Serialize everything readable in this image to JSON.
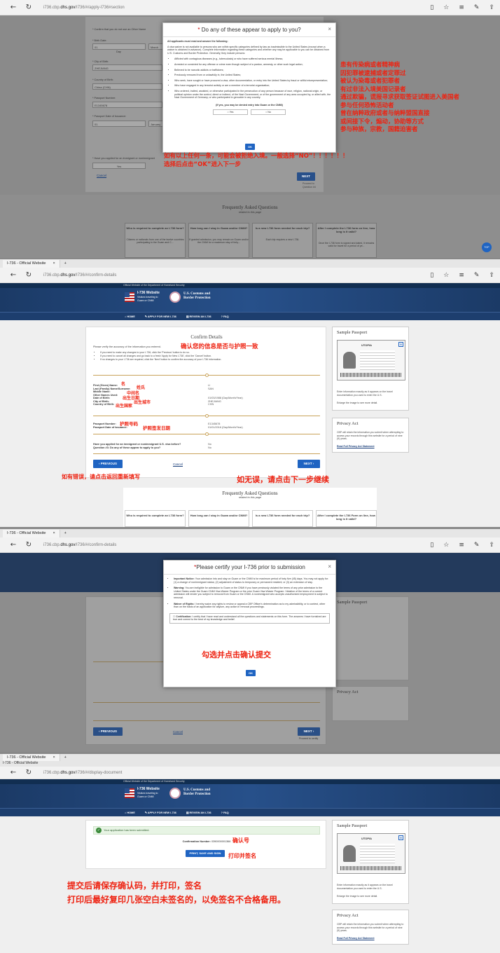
{
  "panel1": {
    "url_prefix": "i736.cbp.",
    "url_host": "dhs.gov",
    "url_path": "/I736/#/apply-I736#section",
    "confirm_other_name": "* Confirm that you do not use an Other Name",
    "birth_date_label": "* Birth Date:",
    "birth_day": "01",
    "birth_month": "March",
    "day_hint": "Day",
    "city_birth_label": "* City of Birth:",
    "city_birth": "ZHEJIANG",
    "country_birth_label": "* Country of Birth:",
    "country_birth": "China (CHN)",
    "passport_label": "* Passport Number:",
    "passport_number": "E1345678",
    "issuance_label": "* Passport Date of Issuance:",
    "issue_day": "01",
    "issue_month": "January",
    "applied_label": "* Have you applied for an immigrant or nonimmigrant",
    "yes_label": "Yes",
    "cancel": "Cancel",
    "next": "NEXT",
    "proceed": "Proceed to Question #4",
    "faq_title": "Frequently Asked Questions",
    "faq_sub": "related to this page",
    "faq": [
      {
        "q": "Who is required to complete an I-736 form?",
        "a": "Citizens or nationals from one of the twelve countries participating in the Guam and C..."
      },
      {
        "q": "How long can I stay in Guam and/or CNMI?",
        "a": "If granted admission, you may remain on Guam and/or the CNMI for a maximum stay of forty..."
      },
      {
        "q": "Is a new I-736 form needed for each trip?",
        "a": "Each trip requires a new I-736."
      },
      {
        "q": "After I complete the I-736 form on line, how long is it valid?",
        "a": "Once the I-736 form is signed and dated, it remains valid for travel for a period of ye..."
      }
    ],
    "top_label": "TOP",
    "modal": {
      "title": "Do any of these appear to apply to you?",
      "required_star": "*",
      "subhead": "All applicants must read and answer the following:",
      "intro": "A visa waiver is not available to persons who are within specific categories defined by law as inadmissible to the United States (except when a waiver is obtained in advance). Complete information regarding these categories and whether any may be applicable to you can be obtained from U.S. Customs and Border Protection. Generally, they include persons:",
      "items": [
        "Afflicted with contagious diseases (e.g., tuberculosis) or who have suffered serious mental illness;",
        "Arrested or convicted for any offense or crime even though subject of a pardon, amnesty, or other such legal action;",
        "Believed to be narcotic addicts or traffickers;",
        "Previously removed from or unlawfully in, the United States;",
        "Who seek, have sought or have procured a visa, other documentation, or entry into the United States by fraud or willful misrepresentation;",
        "Who have engaged in any terrorist activity or are a member of a terrorist organization;",
        "Who ordered, incited, assisted, or otherwise participated in the persecution of any person because of race, religion, national origin, or political opinion under the control, direct or indirect, of the Nazi Government, or of the government of any area occupied by, or allied with, the Nazi Government of Germany, or who participated in genocide in any country."
      ],
      "question": "(If yes, you may be denied entry into Guam or the CNMI)",
      "yes": "Yes",
      "no": "No",
      "ok": "OK"
    },
    "annot_right": [
      "患有传染病或者精神病",
      "因犯罪被逮捕或者定罪过",
      "被认为染毒或者犯罪者",
      "有过非法入境美国记录者",
      "通过欺骗，谎报寻求获取签证试图进入美国者",
      "参与任何恐怖活动者",
      "曾在纳粹政府或者与纳粹盟国直接",
      "或间接下令，煽动，协助等方式",
      "参与种族，宗教，国籍迫害者"
    ],
    "annot_bottom": [
      "如有以上任何一条，可能会被拒绝入境。一般选择“NO”！！！！！！",
      "选择后点击“OK”进入下一步"
    ]
  },
  "panel2": {
    "tab_title": "I-736 - Official Website",
    "url_prefix": "i736.cbp.",
    "url_host": "dhs.gov",
    "url_path": "/I736/#/confirm-details",
    "official": "Official Website of the Department of Homeland Security",
    "site_title": "I-736 Website",
    "site_sub1": "Visitors traveling to",
    "site_sub2": "Guam or CNMI",
    "cbp1": "U.S. Customs and",
    "cbp2": "Border Protection",
    "menu": [
      "HOME",
      "APPLY FOR NEW I-736",
      "REVIEW AN I-736",
      "FAQ"
    ],
    "heading": "Confirm Details",
    "verify": "Please verify the accuracy of the information you entered.",
    "bullets": [
      "If you need to make any changes to your I-736, click the 'Previous' button to do so.",
      "If you need to cancel all changes and go back to a fresh 'Apply for New I-736', click the 'Cancel' button.",
      "If no changes to your I-736 are required, click the 'Next' button to confirm the accuracy of your I-736 information."
    ],
    "fields": [
      "First (Given) Name:",
      "Last (Family) Name/Surname:",
      "Middle Name:",
      "Other Names Used:",
      "Date of Birth:",
      "City of Birth:",
      "Country of Birth:"
    ],
    "values": [
      "LI",
      "SAN",
      "",
      "",
      "01/03/1988 (Day/Month/Year)",
      "ZHEJIANG",
      "CHN"
    ],
    "pp_fields": [
      "Passport Number:",
      "Passport Date of Issuance:"
    ],
    "pp_values": [
      "E1345678",
      "01/01/2016 (Day/Month/Year)"
    ],
    "q_fields": [
      "Have you applied for an immigrant or nonimmigrant U.S. visa before?",
      "Question #3: Do any of these appear to apply to you?"
    ],
    "q_values": [
      "No",
      "No"
    ],
    "previous": "PREVIOUS",
    "cancel": "Cancel",
    "next": "NEXT",
    "sample_passport": "Sample Passport",
    "utopia": "UTOPIA",
    "sample_desc": "Enter information exactly as it appears on the travel documentation you used to enter the U.S.",
    "enlarge": "Enlarge the image to see more detail.",
    "privacy_title": "Privacy Act",
    "privacy_text": "CBP will retain the information you submit when attempting to access your records through this website for a period of nine (9) years.",
    "privacy_link": "Read Full Privacy Act Statement",
    "faq_title": "Frequently Asked Questions",
    "faq_sub": "related to this page",
    "faq": [
      "Who is required to complete an I-736 form?",
      "How long can I stay in Guam and/or CNMI?",
      "Is a new I-736 form needed for each trip?",
      "After I complete the I-736 Form on line, how long is it valid?"
    ],
    "annot": {
      "title": "确认您的信息是否与护照一致",
      "given": "名",
      "family": "姓氏",
      "middle": "中间名",
      "dob": "出生日期",
      "city": "出生城市",
      "country": "出生国家",
      "pp": "护照号码",
      "issue": "护照签发日期",
      "wrong": "如有错误，请点击返回重新填写",
      "right": "如无误，请点击下一步继续"
    }
  },
  "panel3": {
    "tab_title": "I-736 - Official Website",
    "url_prefix": "i736.cbp.",
    "url_host": "dhs.gov",
    "url_path": "/I736/#/confirm-details",
    "modal_title": "Please certify your I-736 prior to submission",
    "required_star": "*",
    "items": [
      {
        "head": "Important Notice:",
        "text": "Your admission into and stay on Guam or the CNMI is for maximum period of forty five (45) days. You may not apply for: (1) a change of nonimmigrant status; (2) adjustment of status to temporary or permanent resident; or (3) an extension of stay."
      },
      {
        "head": "Warning:",
        "text": "You are ineligible for admission to Guam or the CNMI if you have previously violated the terms of any prior admission to the United States under the Guam CNMI Visa Waiver Program or the prior Guam Visa Waiver Program. Violation of the terms of a current admission will render you subject to removal from Guam or the CNMI. A nonimmigrant who accepts unauthorized employment is subject to removal."
      },
      {
        "head": "Waiver of Rights:",
        "text": "I hereby waive any rights to review or appeal a CBP Officer's determination as to my admissibility, or to contest, other than on the basis of an application for asylum, any action in removal proceedings."
      }
    ],
    "cert_head": "Certification:",
    "cert_text": "I certify that I have read and understand all the questions and statements on this form. The answers I have furnished are true and correct to the best of my knowledge and belief.",
    "ok": "OK",
    "previous": "PREVIOUS",
    "cancel": "Cancel",
    "next": "NEXT",
    "proceed": "Proceed to certify",
    "sample_passport": "Sample Passport",
    "privacy_title": "Privacy Act",
    "annot": "勾选并点击确认提交"
  },
  "panel4": {
    "tab_title": "I-736 - Official Website",
    "tab_title2": "I-736 - Official Website",
    "url_prefix": "i736.cbp.",
    "url_host": "dhs.gov",
    "url_path": "/I736/#/display-document",
    "submitted": "Your application has been submitted.",
    "conf_label": "Confirmation Number:",
    "conf_number": "0390000001366",
    "print": "PRINT, SAVE AND SIGN",
    "sample_passport": "Sample Passport",
    "utopia": "UTOPIA",
    "sample_desc": "Enter information exactly as it appears on the travel documentation you used to enter the U.S.",
    "enlarge": "Enlarge the image to see more detail.",
    "privacy_title": "Privacy Act",
    "privacy_text": "CBP will retain the information you submit when attempting to access your records through this website for a period of nine (9) years.",
    "privacy_link": "Read Full Privacy Act Statement",
    "annot": {
      "conf": "确认号",
      "print": "打印并签名",
      "line1": "提交后请保存确认码，并打印，签名",
      "line2": "打印后最好复印几张空白未签名的，以免签名不合格备用。"
    }
  },
  "colors": {
    "accent": "#1f64c2",
    "navy": "#1d3e6e",
    "annotation": "#e21e1e",
    "gold": "#c9a35a"
  }
}
